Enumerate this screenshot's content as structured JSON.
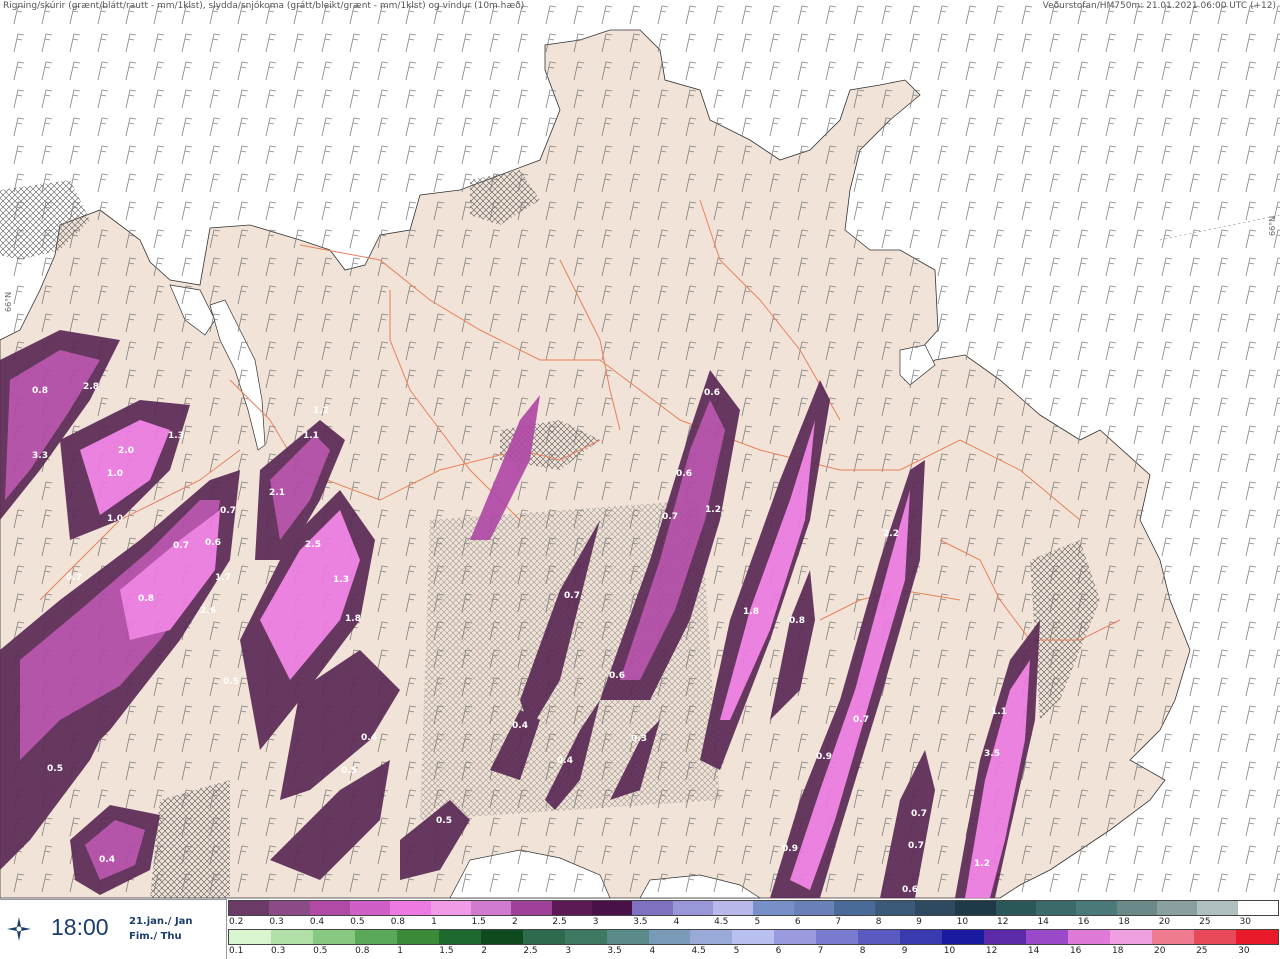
{
  "header": {
    "left": "Rigning/skúrir (grænt/blátt/rautt - mm/1klst), slydda/snjókoma (grátt/bleikt/grænt - mm/1klst) og vindur (10m hæð)",
    "right": "Veðurstofan/HM750m: 21.01.2021 06:00 UTC (+12)"
  },
  "map": {
    "lat_label": "66°N",
    "region": "Northeast Iceland",
    "colors": {
      "sea": "#ffffff",
      "land": "#f1e3d7",
      "roads": "#e8825a",
      "snow_dark": "#5c2a55",
      "snow_mid": "#b04aa6",
      "snow_light": "#ec7ae0"
    },
    "precip_labels": [
      "0.8",
      "2.8",
      "3.3",
      "2.0",
      "1.3",
      "1.0",
      "1.0",
      "0.7",
      "0.7",
      "0.6",
      "0.7",
      "1.7",
      "0.8",
      "2.6",
      "2.1",
      "2.5",
      "1.3",
      "1.8",
      "1.2",
      "1.1",
      "0.5",
      "0.5",
      "0.4",
      "0.5",
      "0.4",
      "0.4",
      "0.5",
      "0.4",
      "0.6",
      "0.3",
      "0.7",
      "0.6",
      "0.6",
      "0.7",
      "1.2",
      "1.8",
      "0.8",
      "2.2",
      "0.7",
      "0.9",
      "0.9",
      "0.7",
      "3.5",
      "1.1",
      "1.2",
      "0.7",
      "0.6"
    ]
  },
  "time": {
    "value": "18:00",
    "date_line1": "21.jan./ Jan",
    "date_line2": "Fim./ Thu",
    "icon": "wind-rose-icon"
  },
  "legend": {
    "snow_ticks": [
      "0.2",
      "0.3",
      "0.4",
      "0.5",
      "0.8",
      "1",
      "1.5",
      "2",
      "2.5",
      "3",
      "3.5",
      "4",
      "4.5",
      "5",
      "6",
      "7",
      "8",
      "9",
      "10",
      "12",
      "14",
      "16",
      "18",
      "20",
      "25",
      "30"
    ],
    "snow_colors": [
      "#6b3a66",
      "#8a4b86",
      "#b04aa6",
      "#d060c8",
      "#ec7ae0",
      "#f09ae8",
      "#d07ad0",
      "#a0409a",
      "#5c1a55",
      "#4a1048",
      "#8070c0",
      "#9898d8",
      "#b8b8ea",
      "#7890c8",
      "#6a80b8",
      "#4a6a98",
      "#3a5a78",
      "#2e4a60",
      "#1e3a48",
      "#2a5858",
      "#3a6a6a",
      "#4a7a7a",
      "#6a8a8a",
      "#8aa0a0",
      "#b0c0c0",
      "#ffffff"
    ],
    "rain_ticks": [
      "0.1",
      "0.3",
      "0.5",
      "0.8",
      "1",
      "1.5",
      "2",
      "2.5",
      "3",
      "3.5",
      "4",
      "4.5",
      "5",
      "6",
      "7",
      "8",
      "9",
      "10",
      "12",
      "14",
      "16",
      "18",
      "20",
      "25",
      "30"
    ],
    "rain_colors": [
      "#d8f5d0",
      "#b0e0a8",
      "#88c880",
      "#5aa85a",
      "#3a8a3a",
      "#1e6a2e",
      "#0e4a1e",
      "#2e6a4e",
      "#3e7a62",
      "#5a8a8a",
      "#7a9aba",
      "#9aaad8",
      "#bac0f0",
      "#9a9ae0",
      "#7a7ad0",
      "#5a5ac0",
      "#3a3ab0",
      "#1a1aa0",
      "#5a2aa8",
      "#9a4ac8",
      "#e07ad8",
      "#f0a0e0",
      "#f07a90",
      "#e84a5a",
      "#e81a2a"
    ]
  }
}
